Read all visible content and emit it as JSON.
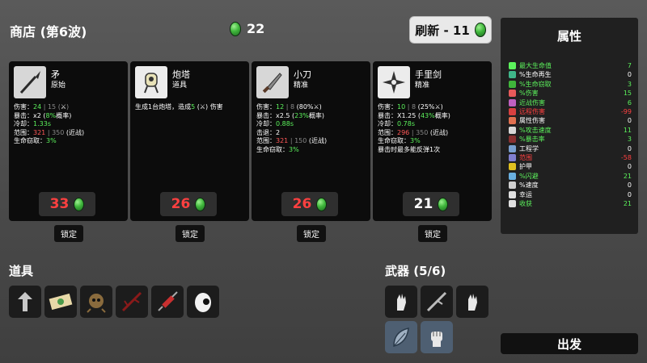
{
  "header": {
    "shop_title": "商店 (第6波)",
    "materials": "22",
    "reroll_label": "刷新 - 11"
  },
  "cards": [
    {
      "name": "矛",
      "type": "原始",
      "stats": [
        {
          "parts": [
            [
              "w",
              "伤害："
            ],
            [
              "g",
              "24"
            ],
            [
              "d",
              " | 15 ("
            ],
            [
              "w",
              "⚔"
            ],
            [
              "d",
              ")"
            ]
          ]
        },
        {
          "parts": [
            [
              "w",
              "暴击：x2 ("
            ],
            [
              "g",
              "8%"
            ],
            [
              "w",
              "概率)"
            ]
          ]
        },
        {
          "parts": [
            [
              "w",
              "冷却："
            ],
            [
              "g",
              "1.33s"
            ]
          ]
        },
        {
          "parts": [
            [
              "w",
              "范围："
            ],
            [
              "r",
              "321"
            ],
            [
              "d",
              " | 350 "
            ],
            [
              "w",
              "(近战)"
            ]
          ]
        },
        {
          "parts": [
            [
              "w",
              "生命窃取："
            ],
            [
              "g",
              "3%"
            ]
          ]
        }
      ],
      "price": "33",
      "lock": "锁定"
    },
    {
      "name": "炮塔",
      "type": "道具",
      "stats": [
        {
          "parts": [
            [
              "w",
              "生成1台炮塔，造成"
            ],
            [
              "g",
              "5"
            ],
            [
              "w",
              " (⚔) 伤害"
            ]
          ]
        }
      ],
      "price": "26",
      "lock": "锁定"
    },
    {
      "name": "小刀",
      "type": "精准",
      "stats": [
        {
          "parts": [
            [
              "w",
              "伤害："
            ],
            [
              "g",
              "12"
            ],
            [
              "d",
              " | 8 "
            ],
            [
              "w",
              "(80%⚔)"
            ]
          ]
        },
        {
          "parts": [
            [
              "w",
              "暴击：x2.5 ("
            ],
            [
              "g",
              "23%"
            ],
            [
              "w",
              "概率)"
            ]
          ]
        },
        {
          "parts": [
            [
              "w",
              "冷却："
            ],
            [
              "g",
              "0.88s"
            ]
          ]
        },
        {
          "parts": [
            [
              "w",
              "击退：2"
            ]
          ]
        },
        {
          "parts": [
            [
              "w",
              "范围："
            ],
            [
              "r",
              "321"
            ],
            [
              "d",
              " | 150 "
            ],
            [
              "w",
              "(近战)"
            ]
          ]
        },
        {
          "parts": [
            [
              "w",
              "生命窃取："
            ],
            [
              "g",
              "3%"
            ]
          ]
        }
      ],
      "price": "26",
      "lock": "锁定"
    },
    {
      "name": "手里剑",
      "type": "精准",
      "stats": [
        {
          "parts": [
            [
              "w",
              "伤害："
            ],
            [
              "g",
              "10"
            ],
            [
              "d",
              " | 8 "
            ],
            [
              "w",
              "(25%⚔)"
            ]
          ]
        },
        {
          "parts": [
            [
              "w",
              "暴击：X1.25 ("
            ],
            [
              "g",
              "43%"
            ],
            [
              "w",
              "概率)"
            ]
          ]
        },
        {
          "parts": [
            [
              "w",
              "冷却："
            ],
            [
              "g",
              "0.78s"
            ]
          ]
        },
        {
          "parts": [
            [
              "w",
              "范围："
            ],
            [
              "r",
              "296"
            ],
            [
              "d",
              " | 350 "
            ],
            [
              "w",
              "(近战)"
            ]
          ]
        },
        {
          "parts": [
            [
              "w",
              "生命窃取："
            ],
            [
              "g",
              "3%"
            ]
          ]
        },
        {
          "parts": [
            [
              "w",
              "暴击时最多能反弹1次"
            ]
          ]
        }
      ],
      "price": "21",
      "lock": "锁定"
    }
  ],
  "items_section": {
    "title": "道具"
  },
  "weapons_section": {
    "title": "武器 (5/6)"
  },
  "stats": {
    "title": "属性",
    "rows": [
      {
        "label": "最大生命值",
        "value": "7",
        "color": "#5cf25c"
      },
      {
        "label": "%生命再生",
        "value": "0",
        "color": "#ffffff"
      },
      {
        "label": "%生命窃取",
        "value": "3",
        "color": "#5cf25c"
      },
      {
        "label": "%伤害",
        "value": "15",
        "color": "#5cf25c"
      },
      {
        "label": "近战伤害",
        "value": "6",
        "color": "#5cf25c"
      },
      {
        "label": "远程伤害",
        "value": "-99",
        "color": "#ff4040"
      },
      {
        "label": "属性伤害",
        "value": "0",
        "color": "#ffffff"
      },
      {
        "label": "%攻击速度",
        "value": "11",
        "color": "#5cf25c"
      },
      {
        "label": "%暴击率",
        "value": "3",
        "color": "#5cf25c"
      },
      {
        "label": "工程学",
        "value": "0",
        "color": "#ffffff"
      },
      {
        "label": "范围",
        "value": "-58",
        "color": "#ff4040"
      },
      {
        "label": "护甲",
        "value": "0",
        "color": "#ffffff"
      },
      {
        "label": "%闪避",
        "value": "21",
        "color": "#5cf25c"
      },
      {
        "label": "%速度",
        "value": "0",
        "color": "#ffffff"
      },
      {
        "label": "幸运",
        "value": "0",
        "color": "#ffffff"
      },
      {
        "label": "收获",
        "value": "21",
        "color": "#5cf25c"
      }
    ]
  },
  "go_label": "出发",
  "colors": {
    "gem_green": "#3fb63b",
    "price_red": "#ff4040",
    "stat_green": "#5cf25c"
  }
}
